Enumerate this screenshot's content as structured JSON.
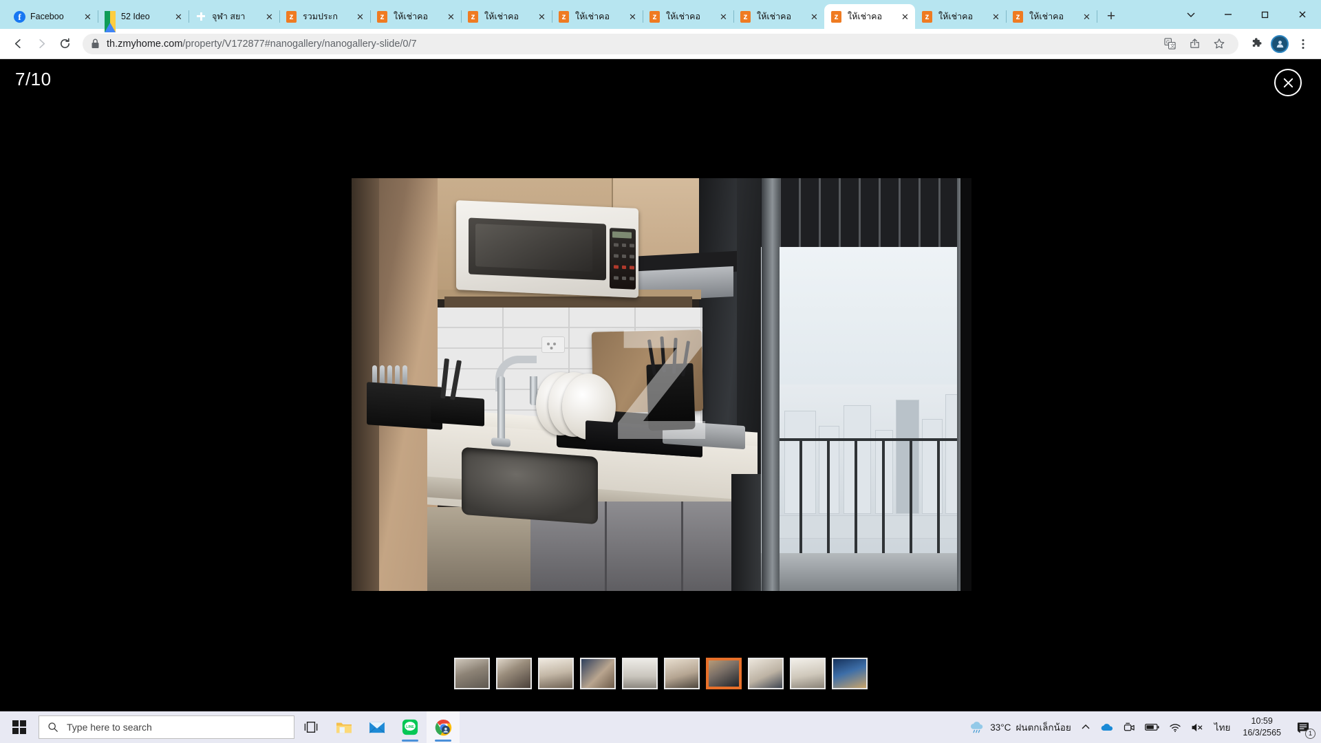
{
  "browser": {
    "tabs": [
      {
        "title": "Faceboo",
        "favicon": "facebook-icon",
        "active": false
      },
      {
        "title": "52 Ideo",
        "favicon": "google-drive-icon",
        "active": false
      },
      {
        "title": "จุฬา สยา",
        "favicon": "green-cross-icon",
        "active": false
      },
      {
        "title": "รวมประก",
        "favicon": "zmyhome-icon",
        "active": false
      },
      {
        "title": "ให้เช่าคอ",
        "favicon": "zmyhome-icon",
        "active": false
      },
      {
        "title": "ให้เช่าคอ",
        "favicon": "zmyhome-icon",
        "active": false
      },
      {
        "title": "ให้เช่าคอ",
        "favicon": "zmyhome-icon",
        "active": false
      },
      {
        "title": "ให้เช่าคอ",
        "favicon": "zmyhome-icon",
        "active": false
      },
      {
        "title": "ให้เช่าคอ",
        "favicon": "zmyhome-icon",
        "active": false
      },
      {
        "title": "ให้เช่าคอ",
        "favicon": "zmyhome-icon",
        "active": true
      },
      {
        "title": "ให้เช่าคอ",
        "favicon": "zmyhome-icon",
        "active": false
      },
      {
        "title": "ให้เช่าคอ",
        "favicon": "zmyhome-icon",
        "active": false
      }
    ],
    "tab_close_label": "✕",
    "new_tab_label": "+",
    "window_controls": {
      "tab_search": "⌄",
      "minimize": "—",
      "maximize": "❐",
      "close": "✕"
    },
    "omnibox": {
      "url_domain": "th.zmyhome.com",
      "url_path": "/property/V172877#nanogallery/nanogallery-slide/0/7",
      "lock_icon": "lock-icon"
    },
    "nav": {
      "back": "back-icon",
      "forward": "forward-icon",
      "reload": "reload-icon"
    },
    "toolbar_icons": [
      "translate-icon",
      "share-icon",
      "bookmark-star-icon",
      "extensions-puzzle-icon",
      "profile-avatar",
      "chrome-menu-icon"
    ]
  },
  "viewer": {
    "counter": "7/10",
    "current_index": 7,
    "total": 10,
    "close_label": "✕",
    "watermark": "Z",
    "image_alt": "condo-kitchen-photo",
    "thumbnails": [
      {
        "name": "thumb-bedroom-1",
        "active": false
      },
      {
        "name": "thumb-bedroom-2",
        "active": false
      },
      {
        "name": "thumb-living-room",
        "active": false
      },
      {
        "name": "thumb-bedroom-3",
        "active": false
      },
      {
        "name": "thumb-bathroom",
        "active": false
      },
      {
        "name": "thumb-laundry",
        "active": false
      },
      {
        "name": "thumb-kitchen",
        "active": true
      },
      {
        "name": "thumb-hallway",
        "active": false
      },
      {
        "name": "thumb-dining",
        "active": false
      },
      {
        "name": "thumb-building-exterior",
        "active": false
      }
    ]
  },
  "taskbar": {
    "start_label": "start-button",
    "search_placeholder": "Type here to search",
    "search_icon": "search-icon",
    "pinned": [
      {
        "name": "task-view-icon"
      },
      {
        "name": "file-explorer-icon"
      },
      {
        "name": "mail-icon"
      },
      {
        "name": "line-icon"
      },
      {
        "name": "chrome-icon"
      }
    ],
    "tray": {
      "weather_icon": "rain-cloud-icon",
      "temperature": "33°C",
      "weather_text": "ฝนตกเล็กน้อย",
      "overflow_icon": "chevron-up-icon",
      "onedrive_icon": "onedrive-icon",
      "camera_icon": "camera-icon",
      "battery_icon": "battery-icon",
      "wifi_icon": "wifi-icon",
      "volume_icon": "volume-muted-icon",
      "language": "ไทย",
      "time": "10:59",
      "date": "16/3/2565",
      "notification_icon": "notification-icon",
      "notification_count": "1"
    }
  },
  "colors": {
    "tabstrip_bg": "#b7e5f0",
    "accent_orange": "#e8702a",
    "zmyhome_orange": "#ef7b22",
    "viewer_bg": "#000000",
    "taskbar_bg": "#e8e9f3"
  }
}
